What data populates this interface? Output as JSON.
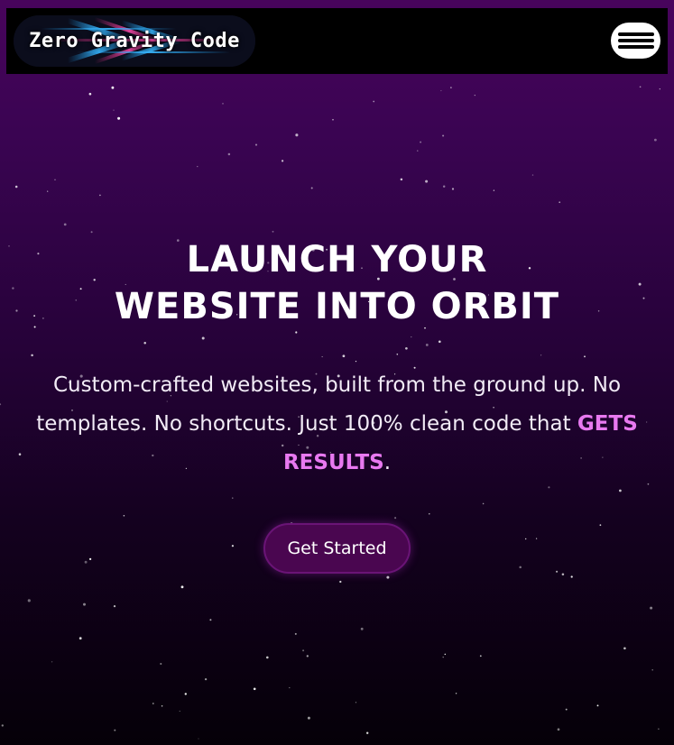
{
  "header": {
    "logo_text": "Zero Gravity Code"
  },
  "hero": {
    "title_line1": "LAUNCH YOUR",
    "title_line2": "WEBSITE INTO ORBIT",
    "subtitle_part1": "Custom-crafted websites, built from the ground up. No templates. No shortcuts. Just 100% clean code that ",
    "subtitle_highlight": "GETS RESULTS",
    "subtitle_end": ".",
    "cta_label": "Get Started"
  },
  "colors": {
    "background_top": "#48045c",
    "background_bottom": "#050008",
    "header_bg": "#000000",
    "accent_pink": "#e879f0",
    "button_bg": "#4a0650"
  },
  "icons": {
    "menu": "hamburger-icon"
  }
}
